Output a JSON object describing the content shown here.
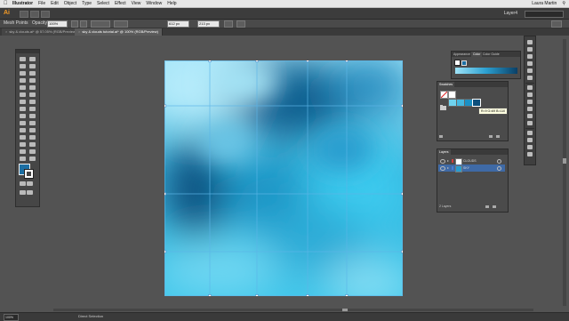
{
  "menubar": {
    "apple": "",
    "items": [
      "Illustrator",
      "File",
      "Edit",
      "Object",
      "Type",
      "Select",
      "Effect",
      "View",
      "Window",
      "Help"
    ],
    "user": "Laura Martin"
  },
  "appbar": {
    "logo": "Ai",
    "workspace": "Layer4"
  },
  "control_bar": {
    "selection_label": "Mesh Points",
    "opacity_label": "Opacity:",
    "opacity_value": "100%",
    "x_value": "612 px",
    "y_value": "213 px"
  },
  "tabs": [
    {
      "label": "sky & clouds.ai* @ 57.05% (RGB/Preview)",
      "active": false
    },
    {
      "label": "sky & clouds tutorial.ai* @ 100% (RGB/Preview)",
      "active": true
    }
  ],
  "colors": {
    "fill": "#1c6fa3",
    "accent": "#1f88b8"
  },
  "appearance_panel": {
    "tabs": [
      "Appearance",
      "Color",
      "Color Guide"
    ]
  },
  "swatches_panel": {
    "title": "Swatches",
    "swatches": [
      "#ffffff",
      "#e8e8e8",
      "#6fd3ef",
      "#44b8e0",
      "#1a90c5",
      "#0d4f7c"
    ],
    "tooltip": "R=9 G=69 B=110"
  },
  "layers_panel": {
    "title": "Layers",
    "layers": [
      {
        "name": "CLOUDS",
        "color": "#d23f3f"
      },
      {
        "name": "SKY",
        "color": "#4a7fd6"
      }
    ],
    "count": "2 Layers"
  },
  "status": {
    "zoom": "100%",
    "tool": "Direct Selection"
  }
}
